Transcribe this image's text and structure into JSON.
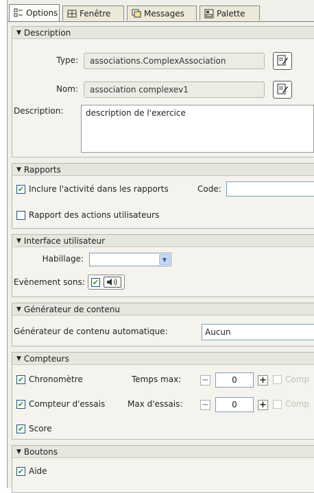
{
  "tabs": [
    {
      "label": "Options",
      "icon": "options-icon",
      "active": true
    },
    {
      "label": "Fenêtre",
      "icon": "window-icon",
      "active": false
    },
    {
      "label": "Messages",
      "icon": "messages-icon",
      "active": false
    },
    {
      "label": "Palette",
      "icon": "palette-icon",
      "active": false
    }
  ],
  "description": {
    "header": "Description",
    "type_label": "Type:",
    "type_value": "associations.ComplexAssociation",
    "nom_label": "Nom:",
    "nom_value": "association complexev1",
    "desc_label": "Description:",
    "desc_value": "description de l'exercice"
  },
  "rapports": {
    "header": "Rapports",
    "include_label": "Inclure l'activité dans les rapports",
    "include_checked": true,
    "code_label": "Code:",
    "code_value": "",
    "user_actions_label": "Rapport des actions utilisateurs",
    "user_actions_checked": false
  },
  "interface": {
    "header": "Interface utilisateur",
    "skin_label": "Habillage:",
    "skin_value": "",
    "sound_label": "Evènement sons:",
    "sound_checked": true
  },
  "generateur": {
    "header": "Générateur de contenu",
    "auto_label": "Générateur de contenu automatique:",
    "auto_value": "Aucun"
  },
  "compteurs": {
    "header": "Compteurs",
    "chrono_label": "Chronomètre",
    "chrono_checked": true,
    "temps_max_label": "Temps max:",
    "temps_max_value": "0",
    "essais_label": "Compteur d'essais",
    "essais_checked": true,
    "max_essais_label": "Max d'essais:",
    "max_essais_value": "0",
    "comp_label": "Comp",
    "score_label": "Score",
    "score_checked": true
  },
  "boutons": {
    "header": "Boutons",
    "aide_label": "Aide",
    "aide_checked": true
  },
  "colors": {
    "check": "#21a121",
    "panel": "#f4f3ee",
    "header": "#e6e5de"
  }
}
